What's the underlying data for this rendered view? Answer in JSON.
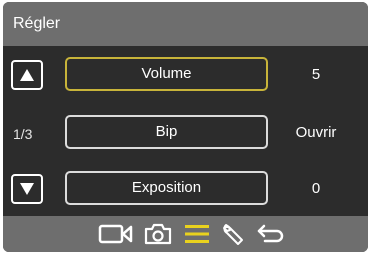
{
  "header": {
    "title": "Régler"
  },
  "pager": {
    "indicator": "1/3"
  },
  "menu": {
    "items": [
      {
        "label": "Volume",
        "value": "5",
        "selected": true
      },
      {
        "label": "Bip",
        "value": "Ouvrir",
        "selected": false
      },
      {
        "label": "Exposition",
        "value": "0",
        "selected": false
      }
    ]
  },
  "nav": {
    "icons": [
      "video-camera-icon",
      "photo-camera-icon",
      "settings-menu-icon",
      "wrench-icon",
      "back-icon"
    ],
    "active": "settings-menu-icon"
  },
  "colors": {
    "header_bg": "#6e6e6e",
    "screen_bg": "#2c2c2c",
    "selected_border": "#c8b43a",
    "active_icon": "#e9d21e"
  }
}
